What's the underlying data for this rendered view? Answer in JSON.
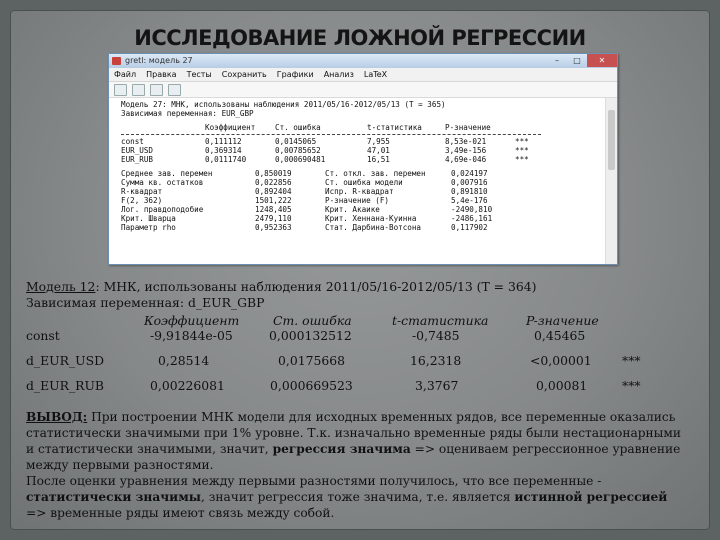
{
  "title": "ИССЛЕДОВАНИЕ ЛОЖНОЙ РЕГРЕССИИ",
  "window": {
    "title": "gretl: модель 27",
    "menu": [
      "Файл",
      "Правка",
      "Тесты",
      "Сохранить",
      "Графики",
      "Анализ",
      "LaTeX"
    ],
    "header_line1": "Модель 27: МНК, использованы наблюдения 2011/05/16-2012/05/13 (T = 365)",
    "header_line2": "Зависимая переменная: EUR_GBP",
    "coef_headers": [
      "",
      "Коэффициент",
      "Ст. ошибка",
      "t-статистика",
      "P-значение",
      ""
    ],
    "coef_rows": [
      [
        "const",
        "0,111112",
        "0,0145065",
        "7,955",
        "8,53e-021",
        "***"
      ],
      [
        "EUR_USD",
        "0,369314",
        "0,00785652",
        "47,01",
        "3,49e-156",
        "***"
      ],
      [
        "EUR_RUB",
        "0,0111740",
        "0,000690481",
        "16,51",
        "4,69e-046",
        "***"
      ]
    ],
    "stats": [
      [
        "Среднее зав. перемен",
        "0,850019",
        "Ст. откл. зав. перемен",
        "0,024197"
      ],
      [
        "Сумма кв. остатков",
        "0,022856",
        "Ст. ошибка модели",
        "0,007916"
      ],
      [
        "R-квадрат",
        "0,892404",
        "Испр. R-квадрат",
        "0,891810"
      ],
      [
        "F(2, 362)",
        "1501,222",
        "Р-значение (F)",
        "5,4e-176"
      ],
      [
        "Лог. правдоподобие",
        "1248,405",
        "Крит. Акаике",
        "-2490,810"
      ],
      [
        "Крит. Шварца",
        "2479,110",
        "Крит. Хеннана-Куинна",
        "-2486,161"
      ],
      [
        "Параметр rho",
        "0,952363",
        "Стат. Дарбина-Вотсона",
        "0,117902"
      ]
    ]
  },
  "model": {
    "label": "Модель 12",
    "label_suffix": ":",
    "method": " МНК, использованы наблюдения 2011/05/16-2012/05/13 (T = 364)",
    "dependent": "Зависимая переменная: d_EUR_GBP"
  },
  "table": {
    "headers": [
      "Коэффициент",
      "Ст. ошибка",
      "t-статистика",
      "P-значение"
    ],
    "rows": [
      {
        "name": "const",
        "coef": "-9,91844e-05",
        "se": "0,000132512",
        "t": "-0,7485",
        "p": "0,45465",
        "sig": ""
      },
      {
        "name": "d_EUR_USD",
        "coef": "0,28514",
        "se": "0,0175668",
        "t": "16,2318",
        "p": "<0,00001",
        "sig": "***"
      },
      {
        "name": "d_EUR_RUB",
        "coef": "0,00226081",
        "se": "0,000669523",
        "t": "3,3767",
        "p": "0,00081",
        "sig": "***"
      }
    ]
  },
  "conclusion": {
    "label": "ВЫВОД:",
    "p1a": " При построении МНК модели для исходных временных рядов, все  переменные оказались статистически значимыми при 1% уровне. Т.к. изначально временные ряды были нестационарными и статистически значимыми, значит, ",
    "p1b": "регрессия значима",
    "p1c": " => оцениваем регрессионное уравнение между первыми разностями.",
    "p2a": "После оценки уравнения между первыми разностями получилось, что все переменные - ",
    "p2b": "статистически значимы",
    "p2c": ", значит регрессия тоже значима, т.е. является ",
    "p2d": "истинной регрессией",
    "p2e": " => временные ряды имеют связь между собой."
  }
}
